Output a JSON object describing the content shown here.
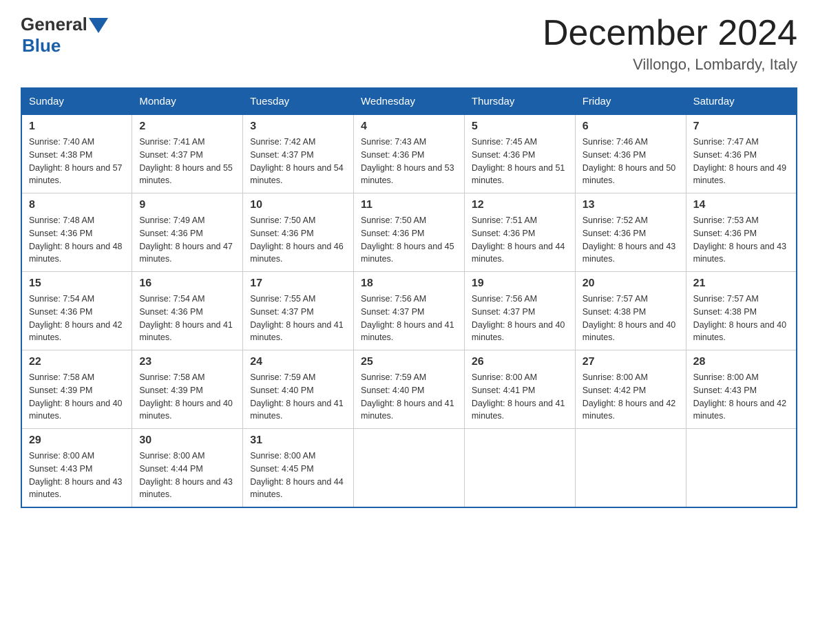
{
  "header": {
    "logo_general": "General",
    "logo_blue": "Blue",
    "month_title": "December 2024",
    "subtitle": "Villongo, Lombardy, Italy"
  },
  "days_of_week": [
    "Sunday",
    "Monday",
    "Tuesday",
    "Wednesday",
    "Thursday",
    "Friday",
    "Saturday"
  ],
  "weeks": [
    [
      {
        "day": "1",
        "sunrise": "7:40 AM",
        "sunset": "4:38 PM",
        "daylight": "8 hours and 57 minutes."
      },
      {
        "day": "2",
        "sunrise": "7:41 AM",
        "sunset": "4:37 PM",
        "daylight": "8 hours and 55 minutes."
      },
      {
        "day": "3",
        "sunrise": "7:42 AM",
        "sunset": "4:37 PM",
        "daylight": "8 hours and 54 minutes."
      },
      {
        "day": "4",
        "sunrise": "7:43 AM",
        "sunset": "4:36 PM",
        "daylight": "8 hours and 53 minutes."
      },
      {
        "day": "5",
        "sunrise": "7:45 AM",
        "sunset": "4:36 PM",
        "daylight": "8 hours and 51 minutes."
      },
      {
        "day": "6",
        "sunrise": "7:46 AM",
        "sunset": "4:36 PM",
        "daylight": "8 hours and 50 minutes."
      },
      {
        "day": "7",
        "sunrise": "7:47 AM",
        "sunset": "4:36 PM",
        "daylight": "8 hours and 49 minutes."
      }
    ],
    [
      {
        "day": "8",
        "sunrise": "7:48 AM",
        "sunset": "4:36 PM",
        "daylight": "8 hours and 48 minutes."
      },
      {
        "day": "9",
        "sunrise": "7:49 AM",
        "sunset": "4:36 PM",
        "daylight": "8 hours and 47 minutes."
      },
      {
        "day": "10",
        "sunrise": "7:50 AM",
        "sunset": "4:36 PM",
        "daylight": "8 hours and 46 minutes."
      },
      {
        "day": "11",
        "sunrise": "7:50 AM",
        "sunset": "4:36 PM",
        "daylight": "8 hours and 45 minutes."
      },
      {
        "day": "12",
        "sunrise": "7:51 AM",
        "sunset": "4:36 PM",
        "daylight": "8 hours and 44 minutes."
      },
      {
        "day": "13",
        "sunrise": "7:52 AM",
        "sunset": "4:36 PM",
        "daylight": "8 hours and 43 minutes."
      },
      {
        "day": "14",
        "sunrise": "7:53 AM",
        "sunset": "4:36 PM",
        "daylight": "8 hours and 43 minutes."
      }
    ],
    [
      {
        "day": "15",
        "sunrise": "7:54 AM",
        "sunset": "4:36 PM",
        "daylight": "8 hours and 42 minutes."
      },
      {
        "day": "16",
        "sunrise": "7:54 AM",
        "sunset": "4:36 PM",
        "daylight": "8 hours and 41 minutes."
      },
      {
        "day": "17",
        "sunrise": "7:55 AM",
        "sunset": "4:37 PM",
        "daylight": "8 hours and 41 minutes."
      },
      {
        "day": "18",
        "sunrise": "7:56 AM",
        "sunset": "4:37 PM",
        "daylight": "8 hours and 41 minutes."
      },
      {
        "day": "19",
        "sunrise": "7:56 AM",
        "sunset": "4:37 PM",
        "daylight": "8 hours and 40 minutes."
      },
      {
        "day": "20",
        "sunrise": "7:57 AM",
        "sunset": "4:38 PM",
        "daylight": "8 hours and 40 minutes."
      },
      {
        "day": "21",
        "sunrise": "7:57 AM",
        "sunset": "4:38 PM",
        "daylight": "8 hours and 40 minutes."
      }
    ],
    [
      {
        "day": "22",
        "sunrise": "7:58 AM",
        "sunset": "4:39 PM",
        "daylight": "8 hours and 40 minutes."
      },
      {
        "day": "23",
        "sunrise": "7:58 AM",
        "sunset": "4:39 PM",
        "daylight": "8 hours and 40 minutes."
      },
      {
        "day": "24",
        "sunrise": "7:59 AM",
        "sunset": "4:40 PM",
        "daylight": "8 hours and 41 minutes."
      },
      {
        "day": "25",
        "sunrise": "7:59 AM",
        "sunset": "4:40 PM",
        "daylight": "8 hours and 41 minutes."
      },
      {
        "day": "26",
        "sunrise": "8:00 AM",
        "sunset": "4:41 PM",
        "daylight": "8 hours and 41 minutes."
      },
      {
        "day": "27",
        "sunrise": "8:00 AM",
        "sunset": "4:42 PM",
        "daylight": "8 hours and 42 minutes."
      },
      {
        "day": "28",
        "sunrise": "8:00 AM",
        "sunset": "4:43 PM",
        "daylight": "8 hours and 42 minutes."
      }
    ],
    [
      {
        "day": "29",
        "sunrise": "8:00 AM",
        "sunset": "4:43 PM",
        "daylight": "8 hours and 43 minutes."
      },
      {
        "day": "30",
        "sunrise": "8:00 AM",
        "sunset": "4:44 PM",
        "daylight": "8 hours and 43 minutes."
      },
      {
        "day": "31",
        "sunrise": "8:00 AM",
        "sunset": "4:45 PM",
        "daylight": "8 hours and 44 minutes."
      },
      null,
      null,
      null,
      null
    ]
  ],
  "labels": {
    "sunrise": "Sunrise:",
    "sunset": "Sunset:",
    "daylight": "Daylight:"
  }
}
